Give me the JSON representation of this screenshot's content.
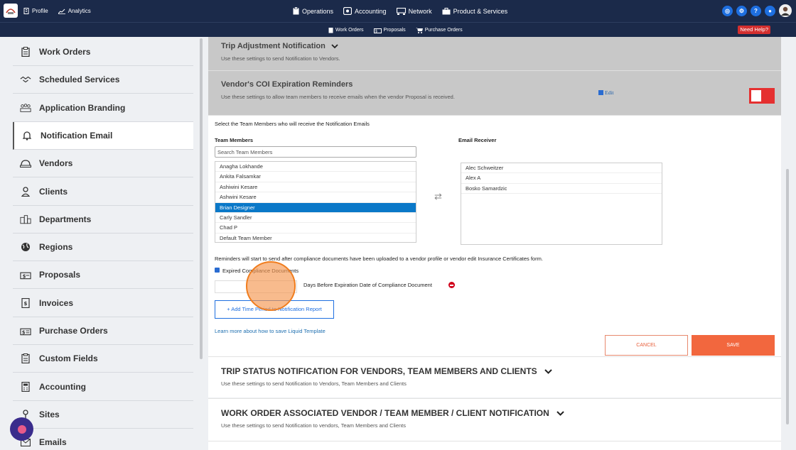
{
  "topbar": {
    "left": [
      {
        "label": "Profile",
        "icon": "building-icon"
      },
      {
        "label": "Analytics",
        "icon": "chart-line-icon"
      }
    ],
    "center": [
      {
        "label": "Operations",
        "icon": "clipboard-icon"
      },
      {
        "label": "Accounting",
        "icon": "calculator-icon"
      },
      {
        "label": "Network",
        "icon": "network-icon"
      },
      {
        "label": "Product & Services",
        "icon": "toolbox-icon"
      }
    ],
    "right_icons": [
      "target-icon",
      "gear-icon",
      "help-icon",
      "chat-icon",
      "avatar"
    ]
  },
  "subbar": {
    "items": [
      {
        "label": "Work Orders",
        "icon": "clipboard-icon"
      },
      {
        "label": "Proposals",
        "icon": "proposal-icon"
      },
      {
        "label": "Purchase Orders",
        "icon": "cart-icon"
      }
    ],
    "need_help": "Need Help?"
  },
  "sidebar": {
    "items": [
      {
        "label": "Work Orders",
        "icon": "clipboard-icon"
      },
      {
        "label": "Scheduled Services",
        "icon": "handshake-icon"
      },
      {
        "label": "Application Branding",
        "icon": "team-icon"
      },
      {
        "label": "Notification Email",
        "icon": "bell-icon",
        "active": true
      },
      {
        "label": "Vendors",
        "icon": "helmet-icon"
      },
      {
        "label": "Clients",
        "icon": "user-icon"
      },
      {
        "label": "Departments",
        "icon": "departments-icon"
      },
      {
        "label": "Regions",
        "icon": "globe-icon"
      },
      {
        "label": "Proposals",
        "icon": "proposal-icon"
      },
      {
        "label": "Invoices",
        "icon": "invoice-icon"
      },
      {
        "label": "Purchase Orders",
        "icon": "purchase-order-icon"
      },
      {
        "label": "Custom Fields",
        "icon": "custom-fields-icon"
      },
      {
        "label": "Accounting",
        "icon": "calculator-icon"
      },
      {
        "label": "Sites",
        "icon": "pin-icon"
      },
      {
        "label": "Emails",
        "icon": "mail-icon"
      }
    ]
  },
  "cards": {
    "trip_adjustment": {
      "title": "Trip Adjustment Notification",
      "desc": "Use these settings to send Notification to Vendors."
    },
    "coi": {
      "title": "Vendor's COI Expiration Reminders",
      "desc": "Use these settings to allow team members to receive emails when the vendor Proposal is received.",
      "edit": "Edit",
      "toggle_on": false
    }
  },
  "form": {
    "select_prompt": "Select the Team Members who will receive the Notification Emails",
    "team_label": "Team Members",
    "receiver_label": "Email Receiver",
    "search_placeholder": "Search Team Members",
    "team_members": [
      "Anagha Lokhande",
      "Ankita Falsamkar",
      "Ashiwini Kesare",
      "Ashwini Kesare",
      "Brian Designer",
      "Carly Sandler",
      "Chad P",
      "Default Team Member"
    ],
    "selected_member": "Brian Designer",
    "receivers": [
      "Alec Schweitzer",
      "Alex A",
      "Bosko Samardzic"
    ],
    "reminder_text": "Reminders will start to send after compliance documents have been uploaded to a vendor profile or vendor edit Insurance Certificates form.",
    "checkbox_label": "Expired Compliance Documents",
    "days_label": "Days Before Expiration Date of Compliance Document",
    "days_value": "",
    "add_button": "+ Add Time Period to Notification Report",
    "learn_link": "Learn more about how to save Liquid Template",
    "cancel": "CANCEL",
    "save": "SAVE"
  },
  "lower_cards": [
    {
      "title": "TRIP STATUS NOTIFICATION FOR VENDORS, TEAM MEMBERS AND CLIENTS",
      "desc": "Use these settings to send Notification to Vendors, Team Members and Clients"
    },
    {
      "title": "WORK ORDER ASSOCIATED VENDOR / TEAM MEMBER / CLIENT NOTIFICATION",
      "desc": "Use these settings to send Notification to vendors, Team Members and Clients"
    }
  ],
  "colors": {
    "topbar": "#1b2a4a",
    "accent_blue": "#1e6fe0",
    "save": "#f2673e",
    "toggle": "#e53030"
  }
}
